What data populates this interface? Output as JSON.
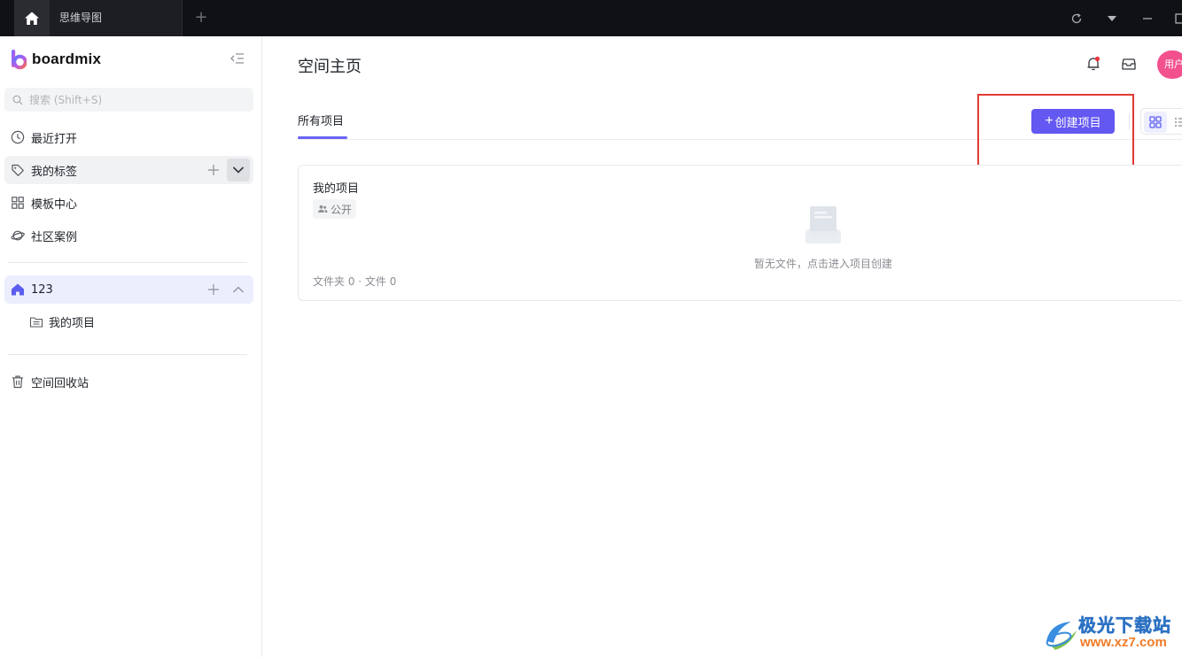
{
  "titlebar": {
    "tab_label": "思维导图",
    "new_tab": "+"
  },
  "sidebar": {
    "logo_text": "boardmix",
    "search_placeholder": "搜索 (Shift+S)",
    "nav": {
      "recent": "最近打开",
      "tags": "我的标签",
      "templates": "模板中心",
      "community": "社区案例"
    },
    "space": {
      "name": "123",
      "project": "我的项目"
    },
    "trash": "空间回收站"
  },
  "main": {
    "title": "空间主页",
    "avatar_text": "用户",
    "tab_all": "所有项目",
    "create_label": "创建项目",
    "create_plus": "+",
    "card": {
      "title": "我的项目",
      "badge": "公开",
      "empty_text": "暂无文件，点击进入项目创建",
      "meta": "文件夹  0 · 文件  0"
    }
  },
  "watermark": {
    "title": "极光下载站",
    "url": "www.xz7.com"
  },
  "colors": {
    "accent": "#6458f2",
    "highlight_box": "#e23a32",
    "avatar": "#f2518e",
    "titlebar": "#101115"
  }
}
